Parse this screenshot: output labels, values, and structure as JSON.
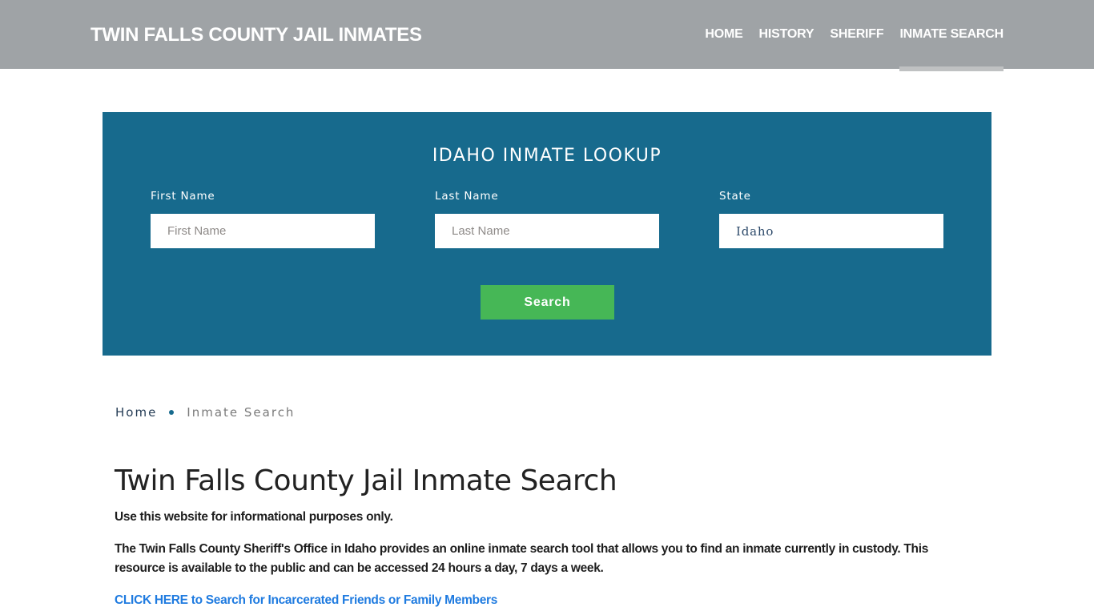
{
  "header": {
    "brand": "TWIN FALLS COUNTY JAIL INMATES",
    "nav": [
      {
        "label": "HOME",
        "active": false
      },
      {
        "label": "HISTORY",
        "active": false
      },
      {
        "label": "SHERIFF",
        "active": false
      },
      {
        "label": "INMATE SEARCH",
        "active": true
      }
    ]
  },
  "lookup": {
    "title": "IDAHO INMATE LOOKUP",
    "first_name": {
      "label": "First Name",
      "placeholder": "First Name",
      "value": ""
    },
    "last_name": {
      "label": "Last Name",
      "placeholder": "Last Name",
      "value": ""
    },
    "state": {
      "label": "State",
      "value": "Idaho"
    },
    "search_label": "Search"
  },
  "breadcrumb": {
    "home": "Home",
    "current": "Inmate Search"
  },
  "content": {
    "title": "Twin Falls County Jail Inmate Search",
    "intro": "Use this website for informational purposes only.",
    "body": "The Twin Falls County Sheriff's Office in Idaho provides an online inmate search tool that allows you to find an inmate currently in custody. This resource is available to the public and can be accessed 24 hours a day, 7 days a week.",
    "cta": "CLICK HERE to Search for Incarcerated Friends or Family Members"
  },
  "colors": {
    "header_bg": "#9fa3a6",
    "lookup_bg": "#176a8d",
    "search_button": "#46b756",
    "link": "#1f7be0"
  }
}
